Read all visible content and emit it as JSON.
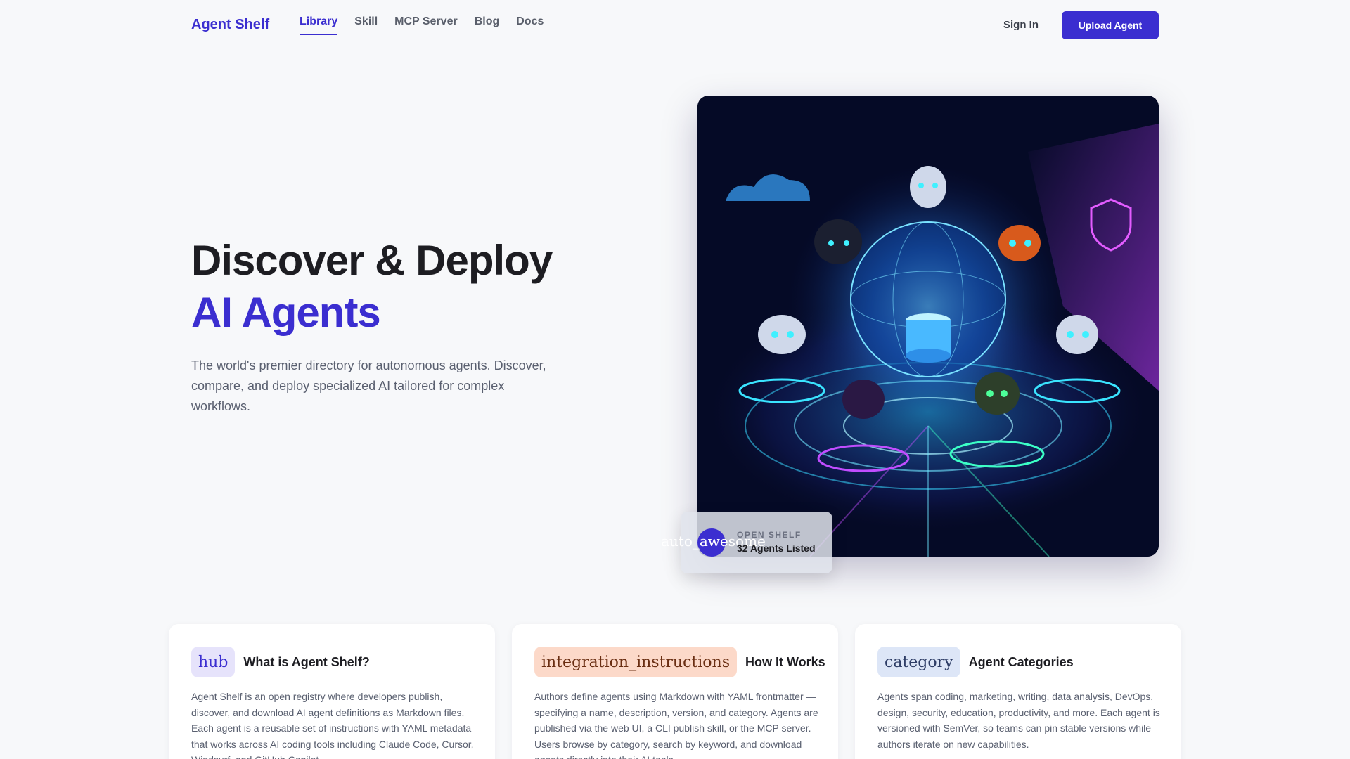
{
  "nav": {
    "brand": "Agent Shelf",
    "links": [
      "Library",
      "Skill",
      "MCP Server",
      "Blog",
      "Docs"
    ],
    "active": "Library",
    "sign_in": "Sign In",
    "upload": "Upload Agent"
  },
  "hero": {
    "title_line1": "Discover & Deploy",
    "title_line2": "AI Agents",
    "description": "The world's premier directory for autonomous agents. Discover, compare, and deploy specialized AI tailored for complex workflows.",
    "badge": {
      "icon_text": "auto_awesome",
      "label": "OPEN SHELF",
      "count": "32 Agents Listed"
    }
  },
  "cards": [
    {
      "icon": "hub",
      "title": "What is Agent Shelf?",
      "body": "Agent Shelf is an open registry where developers publish, discover, and download AI agent definitions as Markdown files. Each agent is a reusable set of instructions with YAML metadata that works across AI coding tools including Claude Code, Cursor, Windsurf, and GitHub Copilot."
    },
    {
      "icon": "integration_instructions",
      "title": "How It Works",
      "body": "Authors define agents using Markdown with YAML frontmatter — specifying a name, description, version, and category. Agents are published via the web UI, a CLI publish skill, or the MCP server. Users browse by category, search by keyword, and download agents directly into their AI tools."
    },
    {
      "icon": "category",
      "title": "Agent Categories",
      "body": "Agents span coding, marketing, writing, data analysis, DevOps, design, security, education, productivity, and more. Each agent is versioned with SemVer, so teams can pin stable versions while authors iterate on new capabilities."
    }
  ],
  "colors": {
    "accent": "#3b2ed0",
    "background": "#f7f8fa"
  }
}
